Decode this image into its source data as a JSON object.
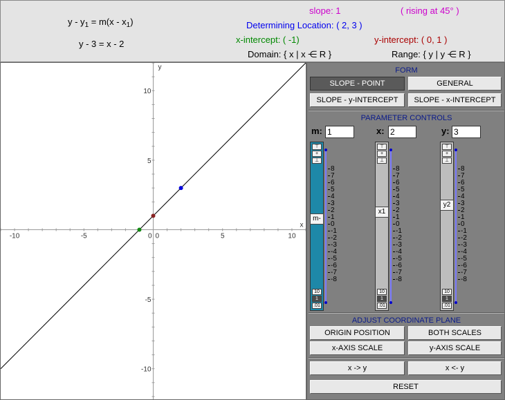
{
  "header": {
    "formula_general": "y - y1 = m(x - x1)",
    "formula_general_parts": {
      "p1": "y - y",
      "s1": "1",
      "p2": " = m(x - x",
      "s2": "1",
      "p3": ")"
    },
    "formula_specific": "y - 3 = x - 2",
    "slope": "slope: 1",
    "rising": "( rising at 45° )",
    "determining_location": "Determining Location: ( 2, 3 )",
    "x_intercept": "x-intercept: ( -1)",
    "y_intercept": "y-intercept: ( 0, 1 )",
    "domain": "Domain: { x | x ⋲ R }",
    "range": "Range: { y | y ⋲ R }",
    "colors": {
      "slope": "#cc00cc",
      "location": "#0000ee",
      "x_intercept": "#008800",
      "y_intercept": "#aa0000"
    }
  },
  "graph": {
    "x_axis_label": "x",
    "y_axis_label": "y",
    "origin_label": "0",
    "x_ticks": [
      "-10",
      "-5",
      "0",
      "5",
      "10"
    ],
    "y_ticks": [
      "10",
      "5",
      "-5",
      "-10"
    ],
    "x_range": [
      -11,
      11
    ],
    "y_range": [
      -12.2,
      12
    ],
    "line": {
      "m": 1,
      "x1": 2,
      "y1": 3,
      "color": "#000000"
    },
    "points": [
      {
        "name": "determining-point",
        "x": 2,
        "y": 3,
        "color": "#0000dd"
      },
      {
        "name": "x-intercept-point",
        "x": -1,
        "y": 0,
        "color": "#118811"
      },
      {
        "name": "y-intercept-point",
        "x": 0,
        "y": 1,
        "color": "#882222"
      }
    ]
  },
  "panel": {
    "form_title": "FORM",
    "form_buttons": {
      "slope_point": "SLOPE - POINT",
      "general": "GENERAL",
      "slope_y_intercept": "SLOPE - y-INTERCEPT",
      "slope_x_intercept": "SLOPE - x-INTERCEPT"
    },
    "parameter_title": "PARAMETER CONTROLS",
    "params": {
      "m": {
        "label": "m:",
        "value": "1",
        "thumb": "m-"
      },
      "x": {
        "label": "x:",
        "value": "2",
        "thumb": "x1"
      },
      "y": {
        "label": "y:",
        "value": "3",
        "thumb": "y2"
      }
    },
    "slider_scale": [
      "8",
      "7",
      "6",
      "5",
      "4",
      "3",
      "2",
      "1",
      "0",
      "-1",
      "-2",
      "-3",
      "-4",
      "-5",
      "-6",
      "-7",
      "-8"
    ],
    "step_buttons": [
      "10",
      "1",
      ".01"
    ],
    "adjust_title": "ADJUST COORDINATE PLANE",
    "adjust_buttons": {
      "origin_position": "ORIGIN POSITION",
      "both_scales": "BOTH SCALES",
      "x_axis_scale": "x-AXIS SCALE",
      "y_axis_scale": "y-AXIS SCALE"
    },
    "swap_buttons": {
      "x_to_y": "x -> y",
      "x_from_y": "x <- y"
    },
    "reset": "RESET"
  }
}
